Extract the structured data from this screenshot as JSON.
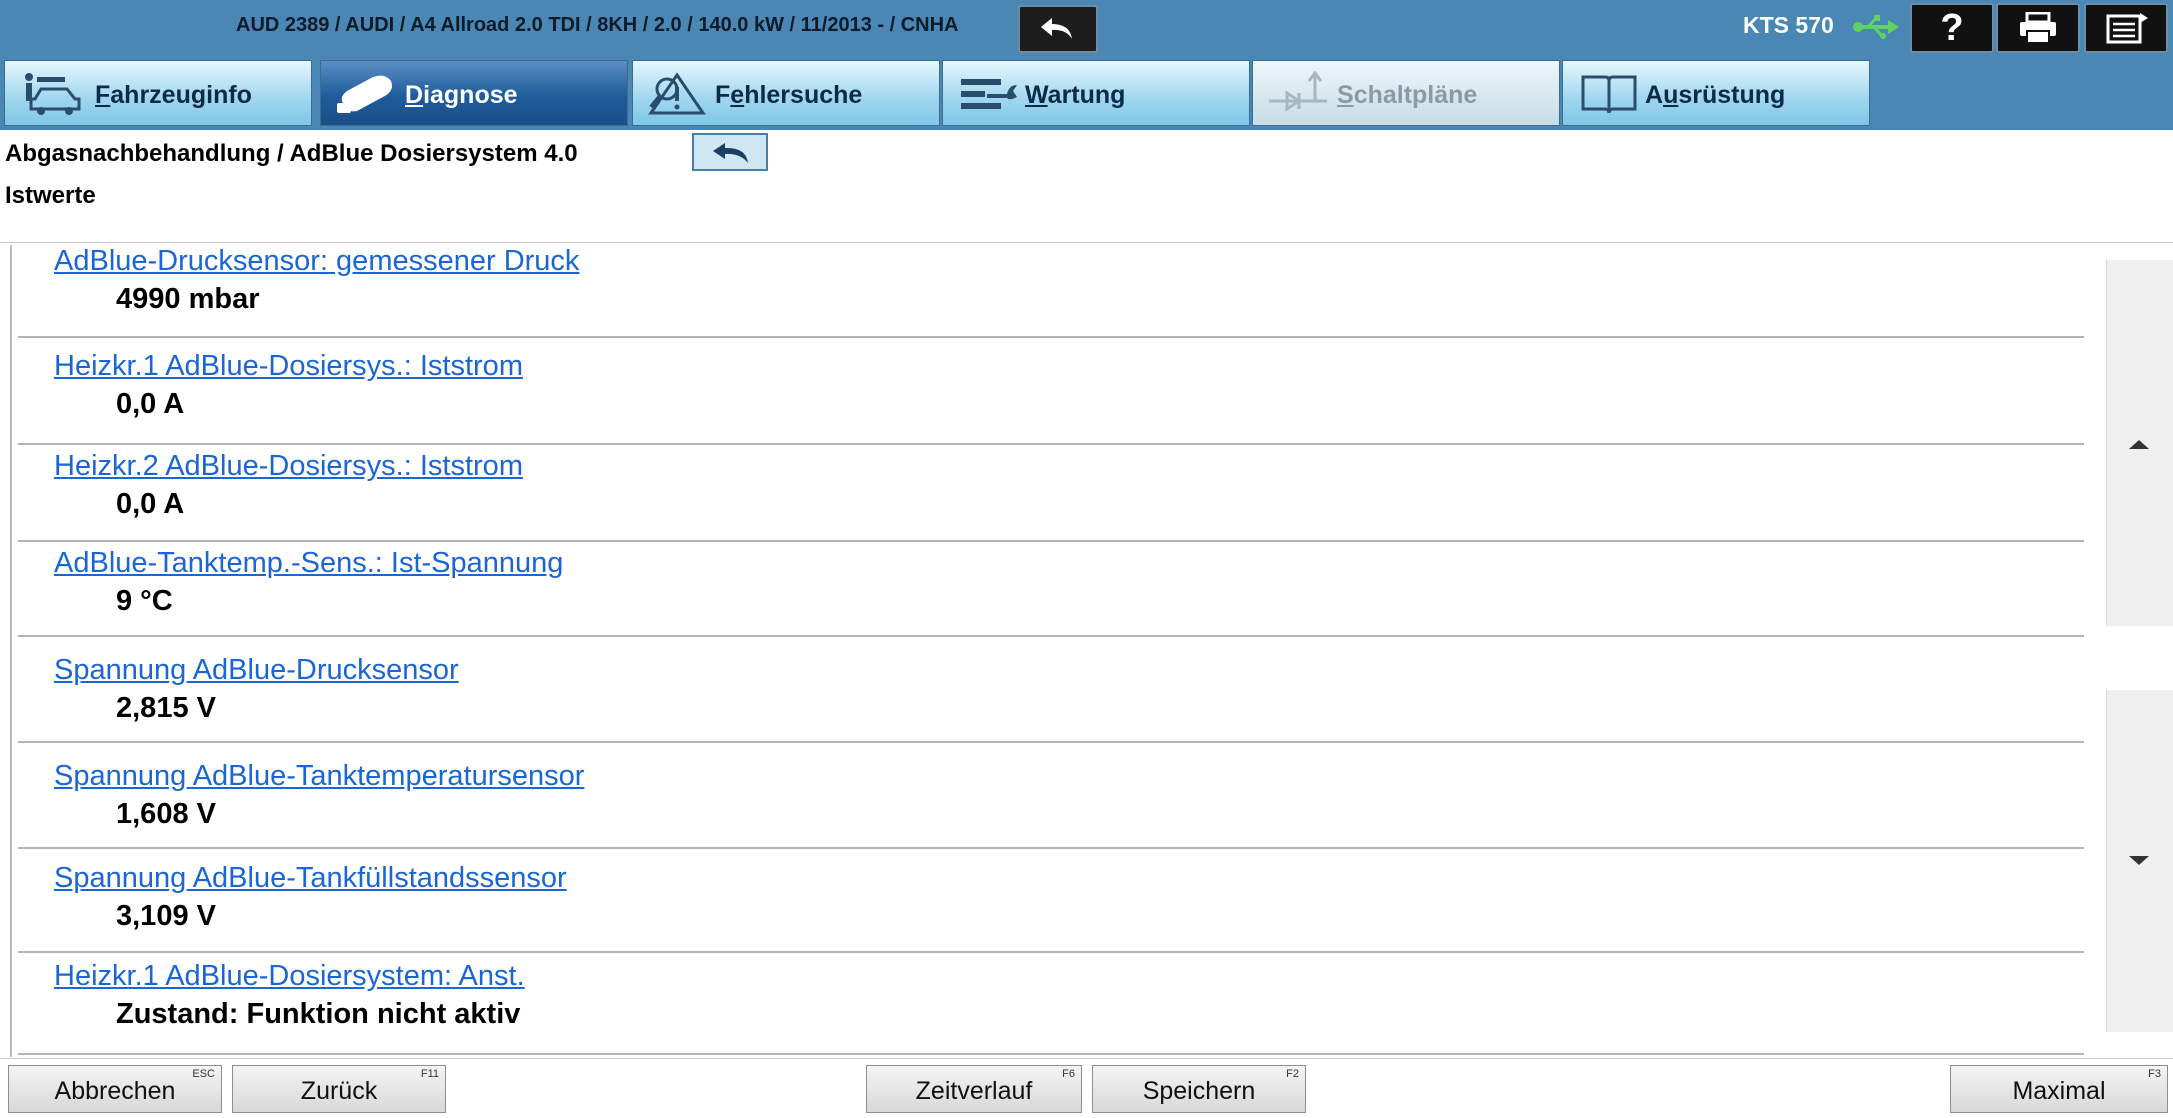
{
  "header": {
    "vehicle_info": "AUD 2389 / AUDI / A4 Allroad 2.0 TDI / 8KH / 2.0 / 140.0 kW / 11/2013 - / CNHA",
    "device": "KTS 570",
    "help_label": "?"
  },
  "tabs": [
    {
      "id": "fahrzeuginfo",
      "key": "F",
      "rest": "ahrzeuginfo",
      "state": "normal",
      "icon": "vehicle-info-icon"
    },
    {
      "id": "diagnose",
      "key": "D",
      "rest": "iagnose",
      "state": "active",
      "icon": "diagnostic-connector-icon"
    },
    {
      "id": "fehlersuche",
      "pre": "F",
      "key": "e",
      "rest": "hlersuche",
      "state": "normal",
      "icon": "warning-search-icon"
    },
    {
      "id": "wartung",
      "key": "W",
      "rest": "artung",
      "state": "normal",
      "icon": "wrench-icon"
    },
    {
      "id": "schaltplane",
      "key": "S",
      "rest": "chaltpläne",
      "state": "disabled",
      "icon": "circuit-diagram-icon"
    },
    {
      "id": "ausruestung",
      "pre": "A",
      "key": "u",
      "rest": "srüstung",
      "state": "normal",
      "icon": "book-icon"
    }
  ],
  "page": {
    "path": "Abgasnachbehandlung / AdBlue Dosiersystem 4.0",
    "subtitle": "Istwerte"
  },
  "values": [
    {
      "name": "AdBlue-Drucksensor: gemessener Druck",
      "value": "4990 mbar"
    },
    {
      "name": "Heizkr.1 AdBlue-Dosiersys.: Iststrom",
      "value": "0,0 A"
    },
    {
      "name": "Heizkr.2 AdBlue-Dosiersys.: Iststrom",
      "value": "0,0 A"
    },
    {
      "name": "AdBlue-Tanktemp.-Sens.: Ist-Spannung",
      "value": "9 °C"
    },
    {
      "name": "Spannung AdBlue-Drucksensor",
      "value": "2,815 V"
    },
    {
      "name": "Spannung AdBlue-Tanktemperatursensor",
      "value": "1,608 V"
    },
    {
      "name": "Spannung AdBlue-Tankfüllstandssensor",
      "value": "3,109 V"
    },
    {
      "name": "Heizkr.1 AdBlue-Dosiersystem: Anst.",
      "value": "Zustand: Funktion nicht aktiv"
    }
  ],
  "footer": {
    "abbrechen": {
      "label": "Abbrechen",
      "key": "ESC"
    },
    "zurueck": {
      "label": "Zurück",
      "key": "F11"
    },
    "zeitverlauf": {
      "label": "Zeitverlauf",
      "key": "F6"
    },
    "speichern": {
      "label": "Speichern",
      "key": "F2"
    },
    "maximal": {
      "label": "Maximal",
      "key": "F3"
    }
  },
  "colors": {
    "topbar": "#4b87b4",
    "link": "#1a66d6",
    "active_tab": "#1f5c9b"
  }
}
